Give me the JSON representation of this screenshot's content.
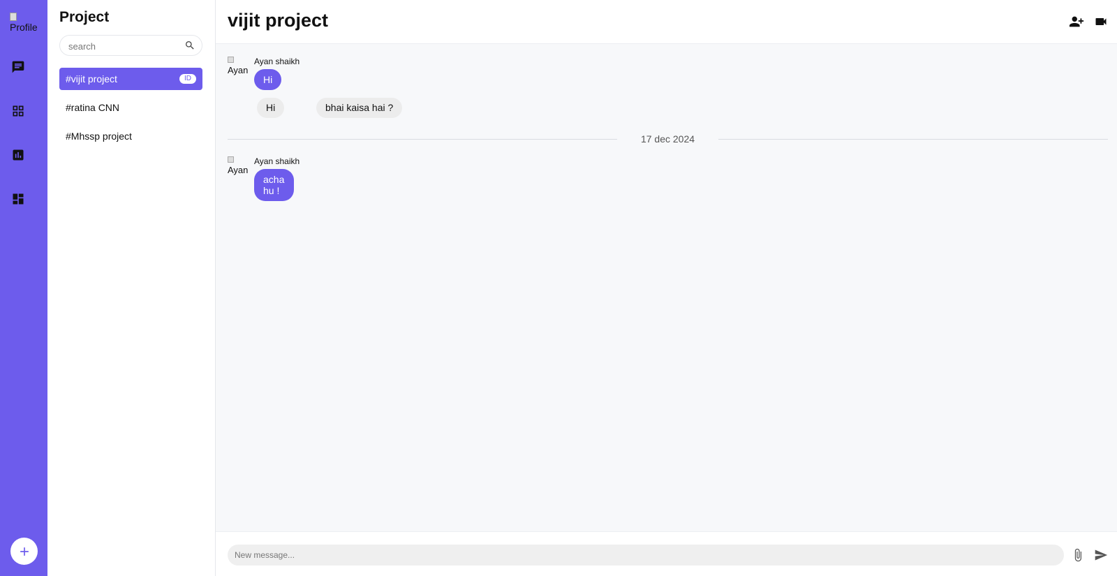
{
  "rail": {
    "profile_alt": "Profile",
    "nav": [
      {
        "icon": "chat-icon"
      },
      {
        "icon": "grid-icon"
      },
      {
        "icon": "bar-chart-icon"
      },
      {
        "icon": "dashboard-icon"
      }
    ],
    "add_icon": "plus-icon"
  },
  "sidebar": {
    "title": "Project",
    "search_placeholder": "search",
    "channels": [
      {
        "label": "#vijit project",
        "badge": "ID",
        "active": true
      },
      {
        "label": "#ratina CNN",
        "active": false
      },
      {
        "label": "#Mhssp project",
        "active": false
      }
    ]
  },
  "chat": {
    "title": "vijit project",
    "header_icons": [
      "add-person-icon",
      "video-camera-icon"
    ],
    "groups": [
      {
        "avatar_alt": "Ayan",
        "sender": "Ayan shaikh",
        "outgoing": [
          "Hi"
        ],
        "incoming": [
          "Hi",
          "bhai kaisa hai ?"
        ]
      },
      {
        "avatar_alt": "Ayan",
        "sender": "Ayan shaikh",
        "outgoing": [
          "acha hu !"
        ]
      }
    ],
    "date_separator": "17 dec 2024"
  },
  "composer": {
    "placeholder": "New message...",
    "attach_icon": "paperclip-icon",
    "send_icon": "send-icon"
  },
  "colors": {
    "accent": "#6d5cec",
    "incoming_bubble": "#ececec",
    "chat_bg": "#f7f8fa"
  }
}
